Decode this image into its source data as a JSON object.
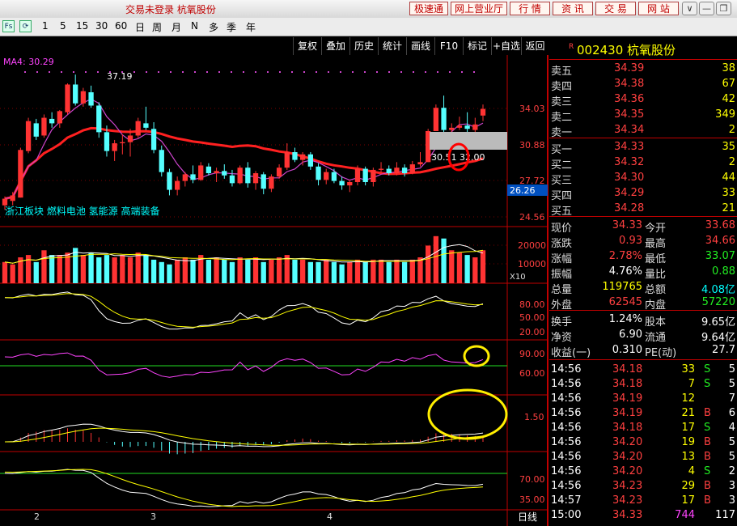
{
  "titlebar": {
    "title": "交易未登录 杭氧股份",
    "buttons": [
      "极速通",
      "网上营业厅",
      "行 情",
      "资 讯",
      "交 易",
      "网 站"
    ],
    "window": [
      "∨",
      "—",
      "❐",
      "✕"
    ]
  },
  "toolbar": {
    "icons": [
      "Fs",
      "⟳"
    ],
    "periods": [
      "1",
      "5",
      "15",
      "30",
      "60",
      "日",
      "周",
      "月",
      "N",
      "多",
      "季",
      "年"
    ]
  },
  "chart_menu": [
    "复权",
    "叠加",
    "历史",
    "统计",
    "画线",
    "F10",
    "标记",
    "+自选",
    "返回"
  ],
  "chart": {
    "ma_label": "MA4: 30.29",
    "peak_label": "37.19",
    "price_axis": [
      "34.03",
      "30.88",
      "27.72",
      "24.56"
    ],
    "current_price_tag": "26.26",
    "ma_tooltip": "30.51 32.00",
    "concepts": "浙江板块 燃料电池 氢能源 高端装备",
    "volume_axis": [
      "20000",
      "10000"
    ],
    "volume_unit": "X10",
    "kdj_axis": [
      "80.00",
      "50.00",
      "20.00"
    ],
    "rsi_axis": [
      "90.00",
      "60.00"
    ],
    "macd_axis": [
      "1.50"
    ],
    "ind4_axis": [
      "70.00",
      "35.00"
    ],
    "date_axis": [
      "2",
      "3",
      "4"
    ],
    "period_label": "日线"
  },
  "chart_data": {
    "type": "candlestick",
    "candles": [
      [
        25.6,
        26.4,
        25.2,
        26.2
      ],
      [
        26.0,
        26.8,
        25.6,
        26.5
      ],
      [
        26.3,
        30.8,
        26.3,
        30.6
      ],
      [
        30.5,
        33.5,
        30.3,
        33.2
      ],
      [
        33.0,
        33.4,
        31.5,
        31.8
      ],
      [
        31.9,
        33.8,
        31.7,
        33.5
      ],
      [
        33.4,
        34.0,
        32.6,
        33.0
      ],
      [
        33.0,
        34.2,
        32.6,
        34.1
      ],
      [
        34.0,
        36.6,
        33.8,
        36.5
      ],
      [
        36.5,
        37.4,
        34.6,
        34.8
      ],
      [
        34.8,
        36.2,
        34.5,
        35.9
      ],
      [
        35.8,
        36.4,
        34.4,
        34.6
      ],
      [
        34.6,
        34.9,
        31.7,
        32.2
      ],
      [
        32.2,
        32.8,
        30.0,
        30.5
      ],
      [
        30.5,
        31.5,
        29.6,
        31.2
      ],
      [
        31.2,
        32.0,
        30.2,
        31.3
      ],
      [
        31.3,
        32.5,
        30.0,
        31.9
      ],
      [
        31.9,
        33.5,
        31.7,
        33.2
      ],
      [
        33.0,
        34.5,
        32.4,
        32.6
      ],
      [
        32.5,
        33.1,
        30.3,
        30.6
      ],
      [
        30.6,
        31.0,
        28.2,
        28.6
      ],
      [
        28.6,
        28.9,
        26.5,
        27.0
      ],
      [
        27.0,
        28.2,
        26.5,
        27.8
      ],
      [
        27.8,
        28.6,
        27.3,
        28.4
      ],
      [
        28.4,
        29.2,
        27.6,
        27.9
      ],
      [
        27.9,
        29.5,
        27.8,
        29.2
      ],
      [
        29.1,
        29.4,
        28.3,
        28.5
      ],
      [
        28.5,
        29.0,
        27.7,
        28.7
      ],
      [
        28.7,
        29.3,
        28.0,
        28.3
      ],
      [
        28.3,
        28.8,
        27.3,
        27.6
      ],
      [
        27.6,
        29.2,
        27.5,
        29.0
      ],
      [
        29.0,
        29.5,
        27.2,
        27.6
      ],
      [
        27.6,
        28.7,
        27.0,
        28.5
      ],
      [
        28.4,
        28.6,
        26.6,
        27.1
      ],
      [
        27.1,
        28.4,
        26.8,
        28.2
      ],
      [
        28.2,
        29.3,
        28.0,
        29.0
      ],
      [
        29.0,
        31.2,
        28.8,
        30.4
      ],
      [
        30.4,
        30.8,
        29.5,
        29.7
      ],
      [
        29.7,
        30.4,
        29.2,
        30.2
      ],
      [
        30.2,
        30.4,
        28.8,
        29.1
      ],
      [
        29.1,
        29.4,
        27.4,
        27.9
      ],
      [
        27.9,
        28.9,
        27.5,
        28.6
      ],
      [
        28.6,
        28.9,
        27.6,
        27.8
      ],
      [
        27.8,
        28.2,
        27.0,
        27.4
      ],
      [
        27.4,
        27.9,
        26.8,
        27.7
      ],
      [
        27.7,
        29.2,
        27.4,
        28.9
      ],
      [
        28.9,
        29.1,
        27.4,
        27.7
      ],
      [
        27.7,
        29.0,
        27.3,
        28.8
      ],
      [
        28.8,
        29.5,
        28.4,
        28.9
      ],
      [
        28.9,
        29.2,
        28.3,
        28.5
      ],
      [
        28.5,
        29.5,
        28.3,
        29.0
      ],
      [
        29.0,
        29.3,
        28.2,
        28.5
      ],
      [
        28.5,
        29.6,
        28.4,
        29.3
      ],
      [
        29.3,
        30.4,
        29.1,
        29.5
      ],
      [
        29.5,
        32.5,
        29.5,
        32.3
      ],
      [
        32.3,
        34.7,
        32.3,
        34.4
      ],
      [
        34.4,
        35.5,
        32.0,
        32.4
      ],
      [
        32.4,
        33.0,
        32.0,
        32.6
      ],
      [
        32.6,
        33.6,
        32.4,
        32.8
      ],
      [
        32.8,
        34.0,
        32.2,
        32.5
      ],
      [
        32.4,
        33.5,
        32.0,
        32.9
      ],
      [
        33.7,
        34.7,
        33.2,
        34.3
      ]
    ],
    "volume": [
      9000,
      8000,
      11000,
      12000,
      9000,
      14000,
      12000,
      12000,
      13000,
      15000,
      12000,
      13000,
      11000,
      12000,
      11000,
      12000,
      11000,
      13000,
      12000,
      10000,
      9000,
      8000,
      10000,
      11000,
      10000,
      12000,
      10000,
      11000,
      10000,
      9000,
      11000,
      10000,
      11000,
      9000,
      10000,
      11000,
      12000,
      10000,
      10000,
      9000,
      9000,
      10000,
      9000,
      8000,
      9000,
      10000,
      9000,
      10000,
      10000,
      9000,
      10000,
      9000,
      10000,
      11000,
      16000,
      20000,
      19000,
      14000,
      13000,
      12000,
      11000,
      14000
    ],
    "ylim": [
      24.56,
      37.19
    ]
  },
  "quote": {
    "code": "002430 杭氧股份",
    "code_prefix": "R",
    "asks": [
      {
        "label": "卖五",
        "price": "34.39",
        "vol": "38"
      },
      {
        "label": "卖四",
        "price": "34.38",
        "vol": "67"
      },
      {
        "label": "卖三",
        "price": "34.36",
        "vol": "42"
      },
      {
        "label": "卖二",
        "price": "34.35",
        "vol": "349"
      },
      {
        "label": "卖一",
        "price": "34.34",
        "vol": "2"
      }
    ],
    "bids": [
      {
        "label": "买一",
        "price": "34.33",
        "vol": "35"
      },
      {
        "label": "买二",
        "price": "34.32",
        "vol": "2"
      },
      {
        "label": "买三",
        "price": "34.30",
        "vol": "44"
      },
      {
        "label": "买四",
        "price": "34.29",
        "vol": "33"
      },
      {
        "label": "买五",
        "price": "34.28",
        "vol": "21"
      }
    ],
    "stats": [
      {
        "l1": "现价",
        "v1": "34.33",
        "c1": "red",
        "l2": "今开",
        "v2": "33.68",
        "c2": "red"
      },
      {
        "l1": "涨跌",
        "v1": "0.93",
        "c1": "red",
        "l2": "最高",
        "v2": "34.66",
        "c2": "red"
      },
      {
        "l1": "涨幅",
        "v1": "2.78%",
        "c1": "red",
        "l2": "最低",
        "v2": "33.07",
        "c2": "grn"
      },
      {
        "l1": "振幅",
        "v1": "4.76%",
        "c1": "wht",
        "l2": "量比",
        "v2": "0.88",
        "c2": "grn"
      },
      {
        "l1": "总量",
        "v1": "119765",
        "c1": "yel",
        "l2": "总额",
        "v2": "4.08亿",
        "c2": "cya"
      },
      {
        "l1": "外盘",
        "v1": "62545",
        "c1": "red",
        "l2": "内盘",
        "v2": "57220",
        "c2": "grn"
      }
    ],
    "stats2": [
      {
        "l1": "换手",
        "v1": "1.24%",
        "l2": "股本",
        "v2": "9.65亿"
      },
      {
        "l1": "净资",
        "v1": "6.90",
        "l2": "流通",
        "v2": "9.64亿"
      },
      {
        "l1": "收益(一)",
        "v1": "0.310",
        "l2": "PE(动)",
        "v2": "27.7"
      }
    ],
    "ticks": [
      {
        "t": "14:56",
        "p": "34.18",
        "v": "33",
        "bs": "S",
        "n": "5"
      },
      {
        "t": "14:56",
        "p": "34.18",
        "v": "7",
        "bs": "S",
        "n": "5"
      },
      {
        "t": "14:56",
        "p": "34.19",
        "v": "12",
        "bs": "",
        "n": "7"
      },
      {
        "t": "14:56",
        "p": "34.19",
        "v": "21",
        "bs": "B",
        "n": "6"
      },
      {
        "t": "14:56",
        "p": "34.18",
        "v": "17",
        "bs": "S",
        "n": "4"
      },
      {
        "t": "14:56",
        "p": "34.20",
        "v": "19",
        "bs": "B",
        "n": "5"
      },
      {
        "t": "14:56",
        "p": "34.20",
        "v": "13",
        "bs": "B",
        "n": "5"
      },
      {
        "t": "14:56",
        "p": "34.20",
        "v": "4",
        "bs": "S",
        "n": "2"
      },
      {
        "t": "14:56",
        "p": "34.23",
        "v": "29",
        "bs": "B",
        "n": "3"
      },
      {
        "t": "14:57",
        "p": "34.23",
        "v": "17",
        "bs": "B",
        "n": "3"
      },
      {
        "t": "15:00",
        "p": "34.33",
        "v": "744",
        "bs": "",
        "n": "117"
      }
    ],
    "colors": {
      "up": "#ff3333",
      "down": "#55ffff",
      "border": "#c00000"
    }
  }
}
